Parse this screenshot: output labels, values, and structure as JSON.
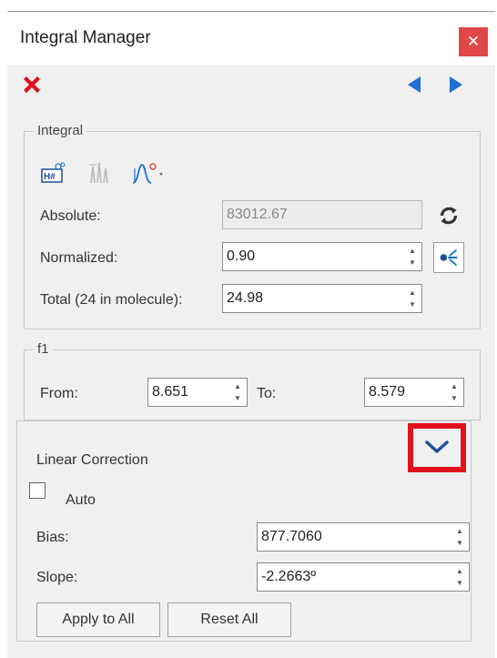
{
  "window": {
    "title": "Integral Manager",
    "close_glyph": "✕"
  },
  "toolbar": {
    "delete_icon": "red-x-delete-icon",
    "prev_icon": "triangle-left-icon",
    "next_icon": "triangle-right-icon"
  },
  "integral": {
    "legend": "Integral",
    "absolute_label": "Absolute:",
    "absolute_value": "83012.67",
    "normalized_label": "Normalized:",
    "normalized_value": "0.90",
    "total_label": "Total (24 in molecule):",
    "total_value": "24.98"
  },
  "f1": {
    "legend": "f1",
    "from_label": "From:",
    "from_value": "8.651",
    "to_label": "To:",
    "to_value": "8.579"
  },
  "linear_correction": {
    "title": "Linear Correction",
    "auto_label": "Auto",
    "auto_checked": false,
    "bias_label": "Bias:",
    "bias_value": "877.7060",
    "slope_label": "Slope:",
    "slope_value": "-2.2663º",
    "apply_label": "Apply to All",
    "reset_label": "Reset All"
  },
  "colors": {
    "accent_blue": "#1e6fd9",
    "highlight_red": "#e0101c",
    "close_red": "#e04848"
  }
}
